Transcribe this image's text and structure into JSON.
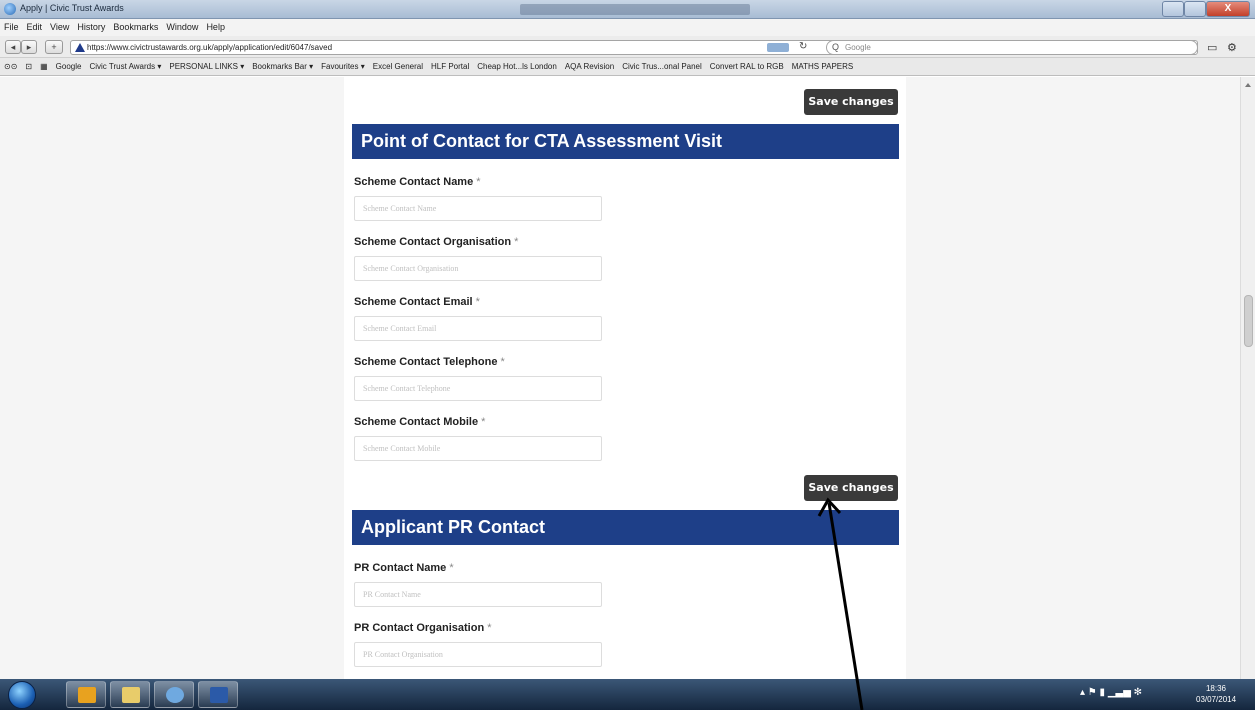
{
  "window": {
    "title": "Apply | Civic Trust Awards",
    "controls": {
      "close_label": "X"
    }
  },
  "menu": [
    "File",
    "Edit",
    "View",
    "History",
    "Bookmarks",
    "Window",
    "Help"
  ],
  "address": {
    "url": "https://www.civictrustawards.org.uk/apply/application/edit/6047/saved",
    "search_placeholder": "Google"
  },
  "bookmarks": [
    "Google",
    "Civic Trust Awards ▾",
    "PERSONAL LINKS ▾",
    "Bookmarks Bar ▾",
    "Favourites ▾",
    "Excel General",
    "HLF Portal",
    "Cheap Hot...ls London",
    "AQA Revision",
    "Civic Trus...onal Panel",
    "Convert RAL to RGB",
    "MATHS PAPERS"
  ],
  "form": {
    "save_label": "Save changes",
    "section1": {
      "title": "Point of Contact for CTA Assessment Visit",
      "fields": [
        {
          "label": "Scheme Contact Name",
          "placeholder": "Scheme Contact Name"
        },
        {
          "label": "Scheme Contact Organisation",
          "placeholder": "Scheme Contact Organisation"
        },
        {
          "label": "Scheme Contact Email",
          "placeholder": "Scheme Contact Email"
        },
        {
          "label": "Scheme Contact Telephone",
          "placeholder": "Scheme Contact Telephone"
        },
        {
          "label": "Scheme Contact Mobile",
          "placeholder": "Scheme Contact Mobile"
        }
      ]
    },
    "section2": {
      "title": "Applicant PR Contact",
      "fields": [
        {
          "label": "PR Contact Name",
          "placeholder": "PR Contact Name"
        },
        {
          "label": "PR Contact Organisation",
          "placeholder": "PR Contact Organisation"
        }
      ]
    },
    "required_marker": "*"
  },
  "taskbar": {
    "clock_time": "18:36",
    "clock_date": "03/07/2014"
  },
  "colors": {
    "section_header": "#1e3f88",
    "save_button": "#3a3a3a"
  }
}
